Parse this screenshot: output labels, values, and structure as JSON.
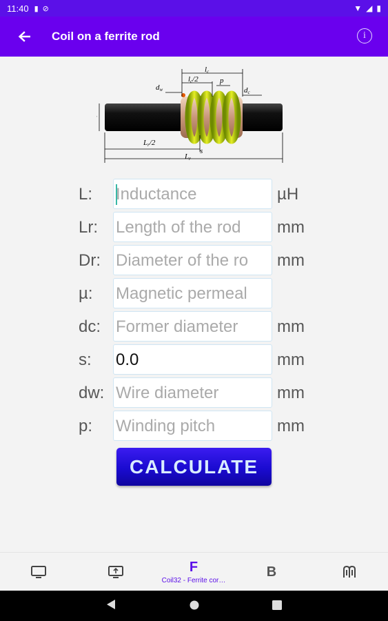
{
  "status_bar": {
    "time": "11:40"
  },
  "app_bar": {
    "title": "Coil on a ferrite rod"
  },
  "form": {
    "rows": [
      {
        "label": "L:",
        "placeholder": "Inductance",
        "value": "",
        "unit": "µH"
      },
      {
        "label": "Lr:",
        "placeholder": "Length of the rod",
        "value": "",
        "unit": "mm"
      },
      {
        "label": "Dr:",
        "placeholder": "Diameter of the ro",
        "value": "",
        "unit": "mm"
      },
      {
        "label": "µ:",
        "placeholder": "Magnetic permeal",
        "value": "",
        "unit": ""
      },
      {
        "label": "dc:",
        "placeholder": "Former diameter",
        "value": "",
        "unit": "mm"
      },
      {
        "label": "s:",
        "placeholder": "",
        "value": "0.0",
        "unit": "mm"
      },
      {
        "label": "dw:",
        "placeholder": "Wire diameter",
        "value": "",
        "unit": "mm"
      },
      {
        "label": "p:",
        "placeholder": "Winding pitch",
        "value": "",
        "unit": "mm"
      }
    ],
    "calculate_label": "CALCULATE"
  },
  "diagram": {
    "labels": {
      "lc": "l",
      "lc2": "l",
      "p": "p",
      "dw": "d",
      "dc": "d",
      "Dr": "D",
      "Lr2": "L",
      "s": "s",
      "Lr": "L"
    },
    "subs": {
      "lc": "c",
      "lc2": "c",
      "dw": "w",
      "dc": "c",
      "Dr": "r",
      "Lr2": "r",
      "Lr": "r"
    },
    "halves": {
      "lc2": "/2",
      "Lr2": "/2"
    }
  },
  "bottom_nav": {
    "items": [
      {
        "icon": "monitor-icon"
      },
      {
        "icon": "screen-icon"
      },
      {
        "letter": "F",
        "label": "Coil32 - Ferrite cor…"
      },
      {
        "letter": "B"
      },
      {
        "icon": "coil-icon"
      }
    ]
  },
  "colors": {
    "accent": "#6a00ee",
    "status": "#5b10e8",
    "button": "#1a0bd0"
  }
}
